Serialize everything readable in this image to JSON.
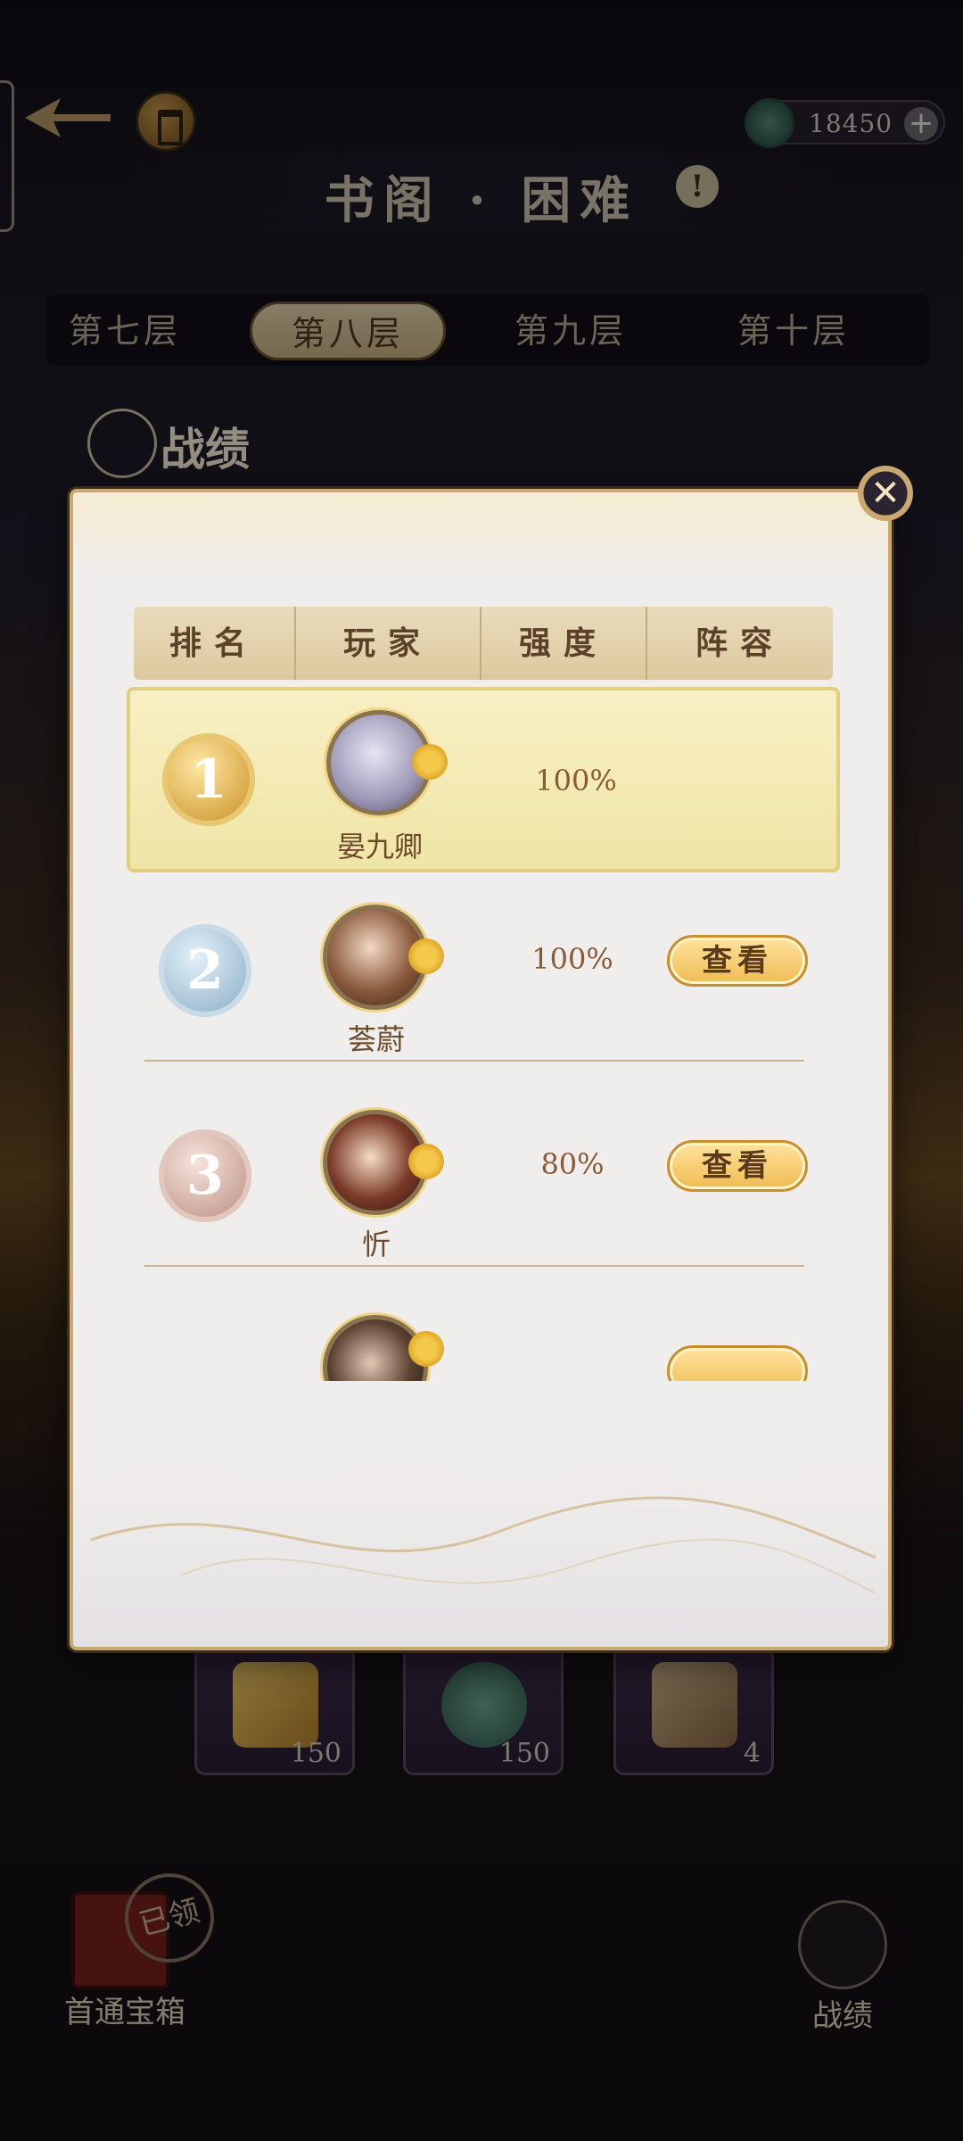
{
  "header": {
    "currency_value": "18450",
    "currency_add": "+",
    "title": "书阁 · 困难",
    "info_icon": "!"
  },
  "tabs": [
    {
      "label": "第七层",
      "active": false
    },
    {
      "label": "第八层",
      "active": true
    },
    {
      "label": "第九层",
      "active": false
    },
    {
      "label": "第十层",
      "active": false
    }
  ],
  "section": {
    "title": "战绩"
  },
  "modal": {
    "close_icon": "close-icon",
    "columns": [
      "排名",
      "玩家",
      "强度",
      "阵容"
    ],
    "rows": [
      {
        "rank": "1",
        "medal": "gold",
        "name": "晏九卿",
        "strength": "100%",
        "action": ""
      },
      {
        "rank": "2",
        "medal": "silver",
        "name": "荟蔚",
        "strength": "100%",
        "action": "查看"
      },
      {
        "rank": "3",
        "medal": "bronze",
        "name": "忻",
        "strength": "80%",
        "action": "查看"
      }
    ]
  },
  "rewards": [
    {
      "icon": "gold-ingot-icon",
      "count": "150"
    },
    {
      "icon": "jade-coin-icon",
      "count": "150"
    },
    {
      "icon": "wood-logs-icon",
      "count": "4"
    }
  ],
  "bottom": {
    "chest_label": "首通宝箱",
    "chest_stamp": "已领",
    "record_label": "战绩"
  },
  "colors": {
    "accent_gold": "#c9a970",
    "button_gold": "#f0bb52",
    "header_tan": "#dcc99e"
  }
}
